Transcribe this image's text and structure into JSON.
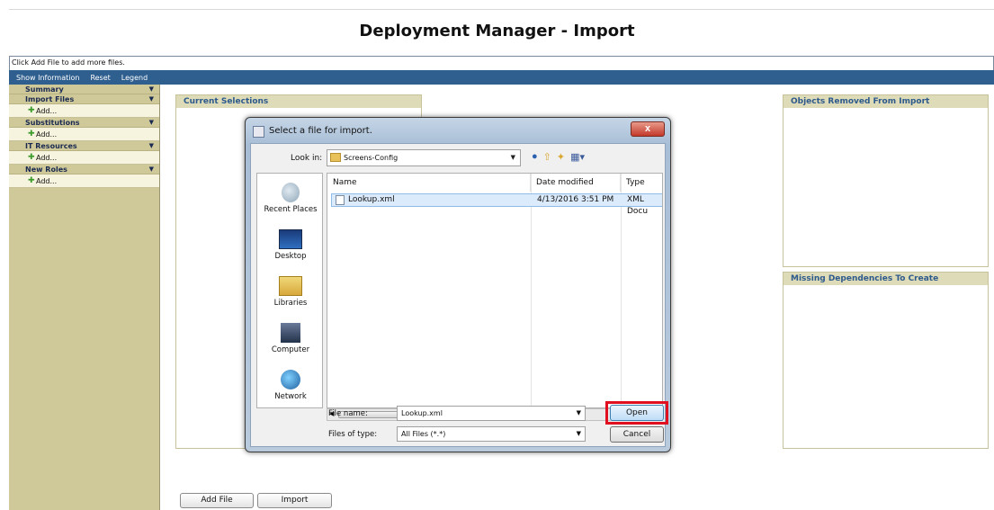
{
  "page": {
    "title": "Deployment Manager - Import",
    "hint": "Click Add File to add more files."
  },
  "toolbar": {
    "show_information": "Show Information",
    "reset": "Reset",
    "legend": "Legend"
  },
  "sidebar": {
    "summary": "Summary",
    "import_files": "Import Files",
    "substitutions": "Substitutions",
    "it_resources": "IT Resources",
    "new_roles": "New Roles",
    "add_label": "Add...",
    "arrow": "▼"
  },
  "panels": {
    "current_selections": "Current Selections",
    "objects_removed": "Objects Removed From Import",
    "missing_dependencies": "Missing Dependencies To Create"
  },
  "bottom_buttons": {
    "add_file": "Add File",
    "import": "Import"
  },
  "dialog": {
    "title": "Select a file for import.",
    "close": "x",
    "look_in_label": "Look in:",
    "look_in_value": "Screens-Config",
    "places": [
      "Recent Places",
      "Desktop",
      "Libraries",
      "Computer",
      "Network"
    ],
    "columns": {
      "name": "Name",
      "date_modified": "Date modified",
      "type": "Type"
    },
    "files": [
      {
        "name": "Lookup.xml",
        "date": "4/13/2016 3:51 PM",
        "type": "XML Docu"
      }
    ],
    "scroll_grip": "III",
    "file_name_label": "File name:",
    "file_name_value": "Lookup.xml",
    "files_of_type_label": "Files of type:",
    "files_of_type_value": "All Files (*.*)",
    "open": "Open",
    "cancel": "Cancel"
  },
  "colors": {
    "toolbar": "#2f5f8f",
    "sidebar": "#cfc99a",
    "panel_title": "#2d5a8c",
    "highlight": "#e01020"
  }
}
